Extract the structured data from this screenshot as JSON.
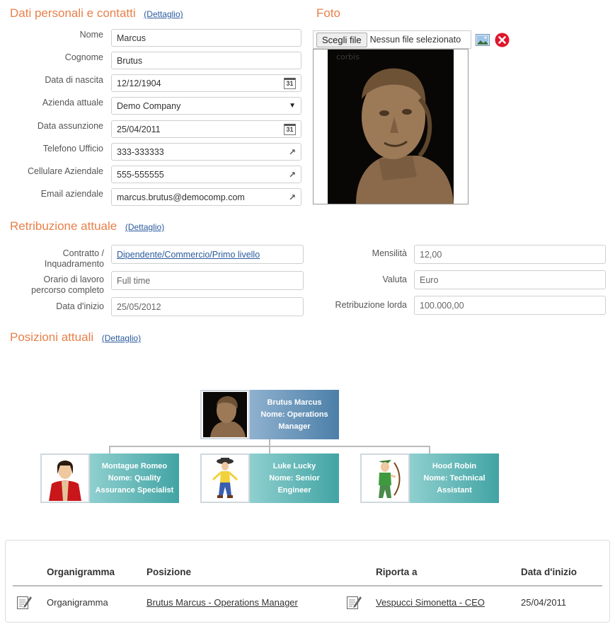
{
  "personal": {
    "title": "Dati personali e contatti",
    "detail_link": "(Dettaglio)",
    "fields": [
      {
        "label": "Nome",
        "value": "Marcus",
        "trail": ""
      },
      {
        "label": "Cognome",
        "value": "Brutus",
        "trail": ""
      },
      {
        "label": "Data di nascita",
        "value": "12/12/1904",
        "trail": "calendar-icon"
      },
      {
        "label": "Azienda attuale",
        "value": "Demo Company",
        "trail": "dropdown-arrow-icon"
      },
      {
        "label": "Data assunzione",
        "value": "25/04/2011",
        "trail": "calendar-icon"
      },
      {
        "label": "Telefono Ufficio",
        "value": "333-333333",
        "trail": "external-link-icon"
      },
      {
        "label": "Cellulare Aziendale",
        "value": "555-555555",
        "trail": "external-link-icon"
      },
      {
        "label": "Email aziendale",
        "value": "marcus.brutus@democomp.com",
        "trail": "external-link-icon"
      }
    ],
    "calendar_glyph": "31",
    "dropdown_glyph": "▼",
    "external_glyph": "↗"
  },
  "photo": {
    "title": "Foto",
    "choose_button": "Scegli file",
    "no_file": "Nessun file selezionato",
    "watermark": "corbis"
  },
  "salary": {
    "title": "Retribuzione attuale",
    "detail_link": "(Dettaglio)",
    "contract_label": "Contratto / Inquadramento",
    "contract_value": "Dipendente/Commercio/Primo livello",
    "schedule_label": "Orario di lavoro percorso completo",
    "schedule_value": "Full time",
    "start_label": "Data d'inizio",
    "start_value": "25/05/2012",
    "months_label": "Mensilità",
    "months_value": "12,00",
    "currency_label": "Valuta",
    "currency_value": "Euro",
    "gross_label": "Retribuzione lorda",
    "gross_value": "100.000,00"
  },
  "positions": {
    "title": "Posizioni attuali",
    "detail_link": "(Dettaglio)",
    "root": {
      "name": "Brutus Marcus",
      "role": "Nome: Operations Manager"
    },
    "children": [
      {
        "name": "Montague Romeo",
        "role": "Nome: Quality Assurance Specialist"
      },
      {
        "name": "Luke Lucky",
        "role": "Nome: Senior Engineer"
      },
      {
        "name": "Hood Robin",
        "role": "Nome: Technical Assistant"
      }
    ]
  },
  "table": {
    "headers": [
      "Organigramma",
      "Posizione",
      "Riporta a",
      "Data d'inizio"
    ],
    "rows": [
      {
        "chart": "Organigramma",
        "position": "Brutus Marcus - Operations Manager",
        "reports_to": "Vespucci Simonetta - CEO",
        "start": "25/04/2011"
      }
    ]
  },
  "colors": {
    "accent": "#e8804a",
    "link": "#2b5a9e",
    "node_blue": "#4c7fa8",
    "node_teal": "#42a4a4"
  }
}
